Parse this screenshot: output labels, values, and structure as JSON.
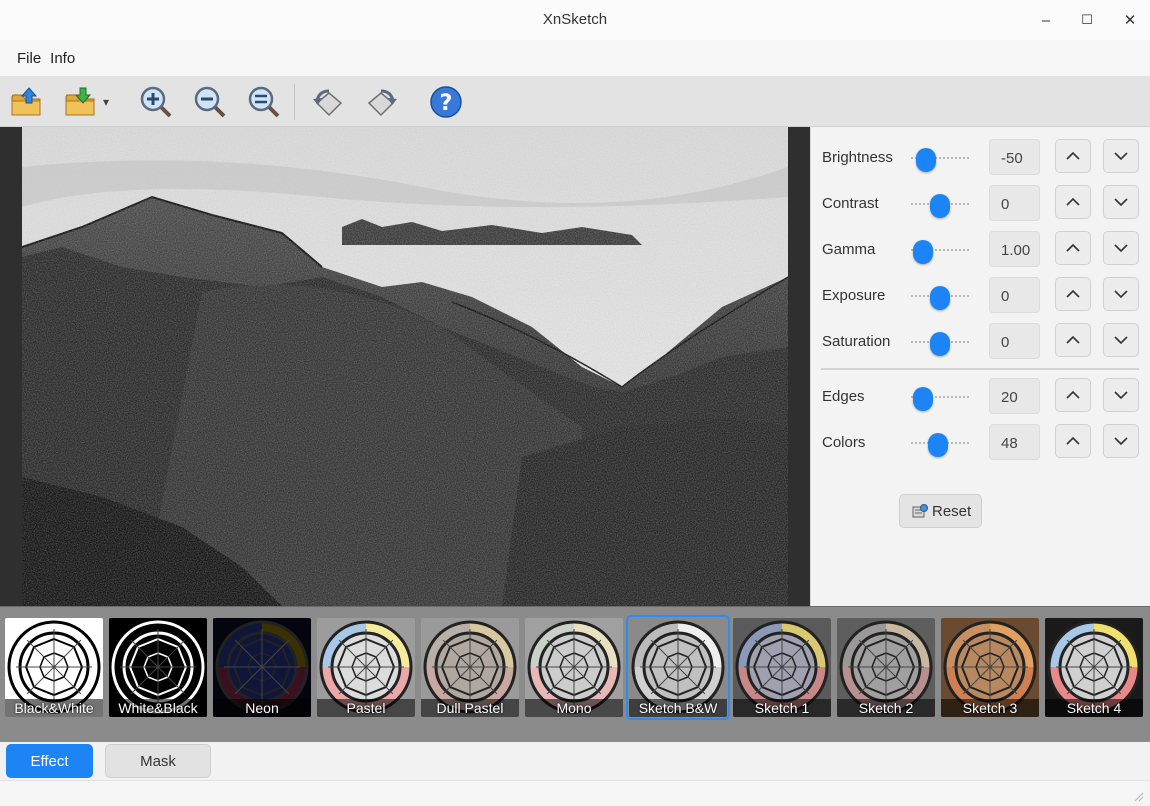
{
  "window": {
    "title": "XnSketch",
    "minimize": "–",
    "maximize": "☐",
    "close": "✕"
  },
  "menu": [
    "File",
    "Info"
  ],
  "toolbar": {
    "icons": [
      "open-icon",
      "save-icon",
      "zoom-in-icon",
      "zoom-out-icon",
      "zoom-fit-icon",
      "rotate-left-icon",
      "rotate-right-icon",
      "help-icon"
    ]
  },
  "adjustments": [
    {
      "label": "Brightness",
      "value": "-50",
      "level": 0.25
    },
    {
      "label": "Contrast",
      "value": "0",
      "level": 0.5
    },
    {
      "label": "Gamma",
      "value": "1.00",
      "level": 0.2
    },
    {
      "label": "Exposure",
      "value": "0",
      "level": 0.5
    },
    {
      "label": "Saturation",
      "value": "0",
      "level": 0.5
    }
  ],
  "adjustments2": [
    {
      "label": "Edges",
      "value": "20",
      "level": 0.2
    },
    {
      "label": "Colors",
      "value": "48",
      "level": 0.47
    }
  ],
  "reset_label": "Reset",
  "effects": [
    {
      "label": "Black&White",
      "selected": false,
      "colors": [
        "#ffffff",
        "#ffffff",
        "#ffffff",
        "#ffffff"
      ],
      "bg": "#ffffff"
    },
    {
      "label": "White&Black",
      "selected": false,
      "colors": [
        "#000000",
        "#000000",
        "#000000",
        "#000000"
      ],
      "bg": "#000000"
    },
    {
      "label": "Neon",
      "selected": false,
      "colors": [
        "#10163a",
        "#3a3004",
        "#3a1020",
        "#10163a"
      ],
      "bg": "#050510"
    },
    {
      "label": "Pastel",
      "selected": false,
      "colors": [
        "#a8c8e8",
        "#f4ec9a",
        "#eaa8a8",
        "#dcdcdc"
      ],
      "bg": "#9c9c9c"
    },
    {
      "label": "Dull Pastel",
      "selected": false,
      "colors": [
        "#b8b0a8",
        "#d8c8a0",
        "#c8a8a0",
        "#b0a8a0"
      ],
      "bg": "#9a9a9a"
    },
    {
      "label": "Mono",
      "selected": false,
      "colors": [
        "#c8d0c8",
        "#e8e0c0",
        "#e8b8b8",
        "#cccccc"
      ],
      "bg": "#a0a0a0"
    },
    {
      "label": "Sketch B&W",
      "selected": true,
      "colors": [
        "#bbbbbb",
        "#eeeeee",
        "#d0d0d0",
        "#c0c0c0"
      ],
      "bg": "#8a8a8a"
    },
    {
      "label": "Sketch 1",
      "selected": false,
      "colors": [
        "#8a9ab8",
        "#d8c870",
        "#c88888",
        "#a0a0b0"
      ],
      "bg": "#5a5a5a"
    },
    {
      "label": "Sketch 2",
      "selected": false,
      "colors": [
        "#9a9898",
        "#c8b8a0",
        "#b89090",
        "#a0a0a0"
      ],
      "bg": "#5e5e5e"
    },
    {
      "label": "Sketch 3",
      "selected": false,
      "colors": [
        "#c89060",
        "#e0a060",
        "#d08050",
        "#b88860"
      ],
      "bg": "#6a4a30"
    },
    {
      "label": "Sketch 4",
      "selected": false,
      "colors": [
        "#a8c8e8",
        "#f0e070",
        "#e88888",
        "#d0d0d0"
      ],
      "bg": "#1a1a1a"
    }
  ],
  "tabs": {
    "effect": "Effect",
    "mask": "Mask"
  }
}
